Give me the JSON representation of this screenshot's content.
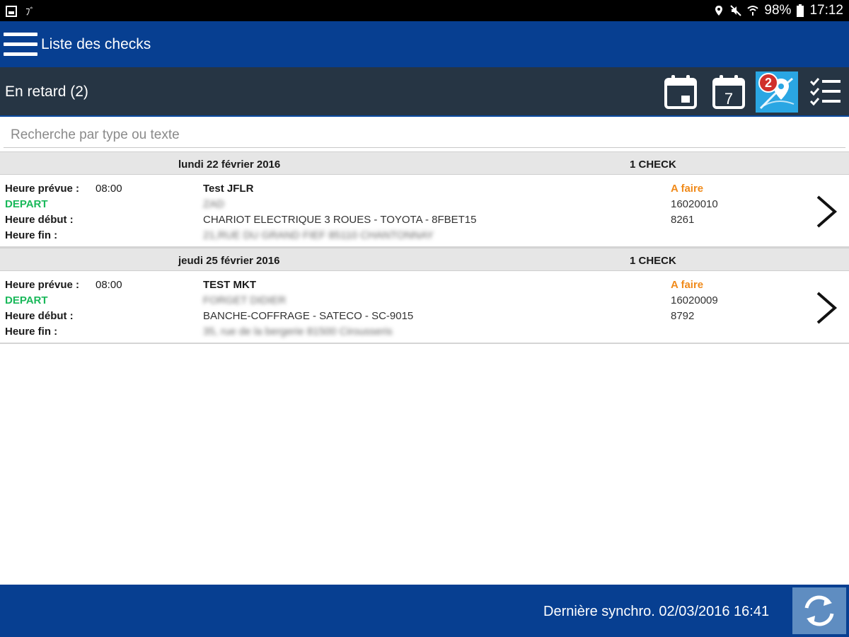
{
  "status_bar": {
    "left_glyph": "ﾌﾞ",
    "battery": "98%",
    "time": "17:12"
  },
  "app_bar": {
    "title": "Liste des checks"
  },
  "toolbar": {
    "title": "En retard (2)",
    "calendar_day": "7",
    "map_badge": "2"
  },
  "search": {
    "placeholder": "Recherche par type ou texte",
    "value": ""
  },
  "groups": [
    {
      "date": "lundi 22 février 2016",
      "count": "1 CHECK",
      "item": {
        "label_planned": "Heure prévue :",
        "planned_time": "08:00",
        "direction": "DEPART",
        "label_start": "Heure début :",
        "label_end": "Heure fin :",
        "name": "Test JFLR",
        "client_blurred": "ZAD",
        "equipment": "CHARIOT ELECTRIQUE 3 ROUES   -   TOYOTA   -   8FBET15",
        "address_blurred": "21,RUE DU GRAND FIEF   85110 CHANTONNAY",
        "status": "A faire",
        "number1": "16020010",
        "number2": "8261"
      }
    },
    {
      "date": "jeudi 25 février 2016",
      "count": "1 CHECK",
      "item": {
        "label_planned": "Heure prévue :",
        "planned_time": "08:00",
        "direction": "DEPART",
        "label_start": "Heure début :",
        "label_end": "Heure fin :",
        "name": "TEST MKT",
        "client_blurred": "FORGET DIDIER",
        "equipment": "BANCHE-COFFRAGE   -   SATECO   -   SC-9015",
        "address_blurred": "35, rue de la bergerie   81500 Cirousseris",
        "status": "A faire",
        "number1": "16020009",
        "number2": "8792"
      }
    }
  ],
  "footer": {
    "sync_label": "Dernière synchro. 02/03/2016 16:41"
  },
  "colors": {
    "app_bar": "#073f91",
    "toolbar": "#263544",
    "status_todo": "#f08a1a",
    "depart": "#19b85a",
    "map_tile": "#2aa6e3",
    "badge": "#d0302c"
  }
}
